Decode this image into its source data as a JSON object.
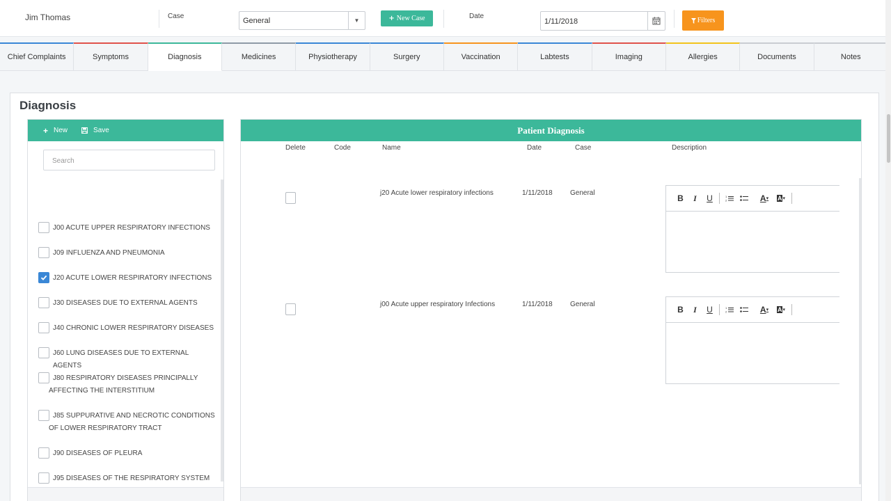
{
  "header": {
    "patient_name": "Jim Thomas",
    "case_label": "Case",
    "case_value": "General",
    "new_case_label": "New Case",
    "date_label": "Date",
    "date_value": "1/11/2018",
    "filters_label": "Filters"
  },
  "tabs": [
    {
      "label": "Chief Complaints",
      "color": "#3a87d6"
    },
    {
      "label": "Symptoms",
      "color": "#e0514b"
    },
    {
      "label": "Diagnosis",
      "color": "#3cb89a"
    },
    {
      "label": "Medicines",
      "color": "#8e9aa6"
    },
    {
      "label": "Physiotherapy",
      "color": "#3a87d6"
    },
    {
      "label": "Surgery",
      "color": "#3a87d6"
    },
    {
      "label": "Vaccination",
      "color": "#f7941d"
    },
    {
      "label": "Labtests",
      "color": "#3a87d6"
    },
    {
      "label": "Imaging",
      "color": "#e0514b"
    },
    {
      "label": "Allergies",
      "color": "#f2c31b"
    },
    {
      "label": "Documents",
      "color": "#c9cdd2"
    },
    {
      "label": "Notes",
      "color": "#c9cdd2"
    }
  ],
  "active_tab": "Diagnosis",
  "panel": {
    "title": "Diagnosis",
    "left": {
      "new_label": "New",
      "save_label": "Save",
      "search_placeholder": "Search",
      "items": [
        {
          "label": "J00 ACUTE UPPER RESPIRATORY INFECTIONS",
          "checked": false
        },
        {
          "label": "J09 INFLUENZA AND PNEUMONIA",
          "checked": false
        },
        {
          "label": "J20 ACUTE LOWER RESPIRATORY INFECTIONS",
          "checked": true
        },
        {
          "label": "J30 DISEASES DUE TO EXTERNAL AGENTS",
          "checked": false
        },
        {
          "label": "J40 CHRONIC LOWER RESPIRATORY DISEASES",
          "checked": false
        },
        {
          "label": "J60 LUNG DISEASES DUE TO EXTERNAL AGENTS",
          "checked": false
        },
        {
          "label": "J80 RESPIRATORY DISEASES PRINCIPALLY AFFECTING THE INTERSTITIUM",
          "checked": false
        },
        {
          "label": "J85 SUPPURATIVE AND NECROTIC CONDITIONS OF LOWER RESPIRATORY TRACT",
          "checked": false
        },
        {
          "label": "J90 DISEASES OF PLEURA",
          "checked": false
        },
        {
          "label": "J95 DISEASES OF THE RESPIRATORY SYSTEM",
          "checked": false
        }
      ]
    },
    "right": {
      "title": "Patient Diagnosis",
      "columns": [
        "Delete",
        "Code",
        "Name",
        "Date",
        "Case",
        "Description"
      ],
      "rows": [
        {
          "name": "j20 Acute lower respiratory infections",
          "date": "1/11/2018",
          "case": "General"
        },
        {
          "name": "j00 Acute upper respiratory Infections",
          "date": "1/11/2018",
          "case": "General"
        }
      ],
      "editor_toolbar": [
        "B",
        "I",
        "U",
        "A",
        "A"
      ]
    }
  }
}
